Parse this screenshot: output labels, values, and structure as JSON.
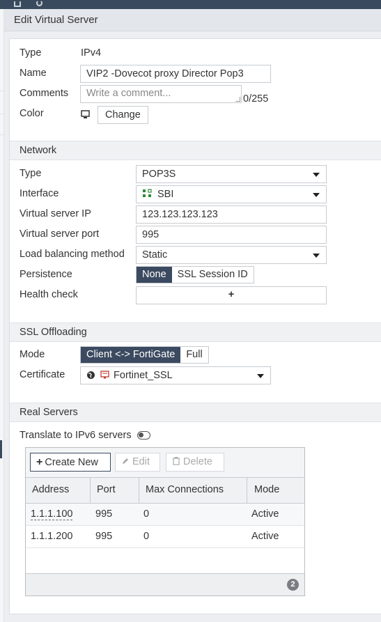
{
  "window": {
    "title": "Edit Virtual Server"
  },
  "general": {
    "type_label": "Type",
    "type_value": "IPv4",
    "name_label": "Name",
    "name_value": "VIP2 -Dovecot proxy Director Pop3",
    "comments_label": "Comments",
    "comments_placeholder": "Write a comment...",
    "comments_counter": "0/255",
    "color_label": "Color",
    "color_change_button": "Change"
  },
  "network": {
    "section_title": "Network",
    "type_label": "Type",
    "type_value": "POP3S",
    "interface_label": "Interface",
    "interface_value": "SBI",
    "vs_ip_label": "Virtual server IP",
    "vs_ip_value": "123.123.123.123",
    "vs_port_label": "Virtual server port",
    "vs_port_value": "995",
    "lb_label": "Load balancing method",
    "lb_value": "Static",
    "persistence_label": "Persistence",
    "persistence_options": [
      "None",
      "SSL Session ID"
    ],
    "persistence_selected": "None",
    "health_label": "Health check",
    "health_add": "+"
  },
  "ssl": {
    "section_title": "SSL Offloading",
    "mode_label": "Mode",
    "mode_options": [
      "Client <-> FortiGate",
      "Full"
    ],
    "mode_selected": "Client <-> FortiGate",
    "cert_label": "Certificate",
    "cert_value": "Fortinet_SSL"
  },
  "real_servers": {
    "section_title": "Real Servers",
    "ipv6_label": "Translate to IPv6 servers",
    "ipv6_enabled": false,
    "toolbar": {
      "create": "Create New",
      "edit": "Edit",
      "delete": "Delete"
    },
    "columns": [
      "Address",
      "Port",
      "Max Connections",
      "Mode"
    ],
    "rows": [
      {
        "address": "1.1.1.100",
        "port": "995",
        "max_conn": "0",
        "mode": "Active"
      },
      {
        "address": "1.1.1.200",
        "port": "995",
        "max_conn": "0",
        "mode": "Active"
      }
    ],
    "count": "2"
  },
  "colors": {
    "accent": "#3b4a60",
    "topbar": "#3a4a5e"
  },
  "icons": {
    "color_icon": "monitor-icon",
    "interface_icon": "port-icon",
    "cert_icons": [
      "globe-icon",
      "certificate-icon"
    ],
    "create_icon": "plus-icon",
    "edit_icon": "pencil-icon",
    "delete_icon": "trash-icon"
  }
}
